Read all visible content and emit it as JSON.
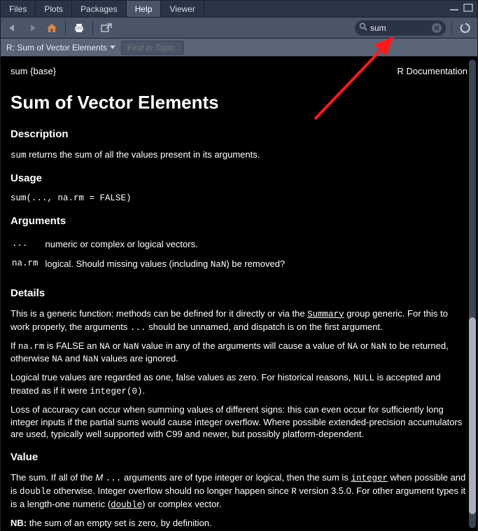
{
  "tabs": {
    "files": "Files",
    "plots": "Plots",
    "packages": "Packages",
    "help": "Help",
    "viewer": "Viewer"
  },
  "search": {
    "value": "sum"
  },
  "subbar": {
    "title": "R: Sum of Vector Elements",
    "find_placeholder": "Find in Topic"
  },
  "doc": {
    "tag": "sum {base}",
    "rdoc": "R Documentation",
    "title": "Sum of Vector Elements",
    "h_desc": "Description",
    "h_usage": "Usage",
    "usage_code": "sum(..., na.rm = FALSE)",
    "h_args": "Arguments",
    "arg1_name": "...",
    "arg1_desc": "numeric or complex or logical vectors.",
    "arg2_name": "na.rm",
    "h_details": "Details",
    "h_value": "Value"
  }
}
